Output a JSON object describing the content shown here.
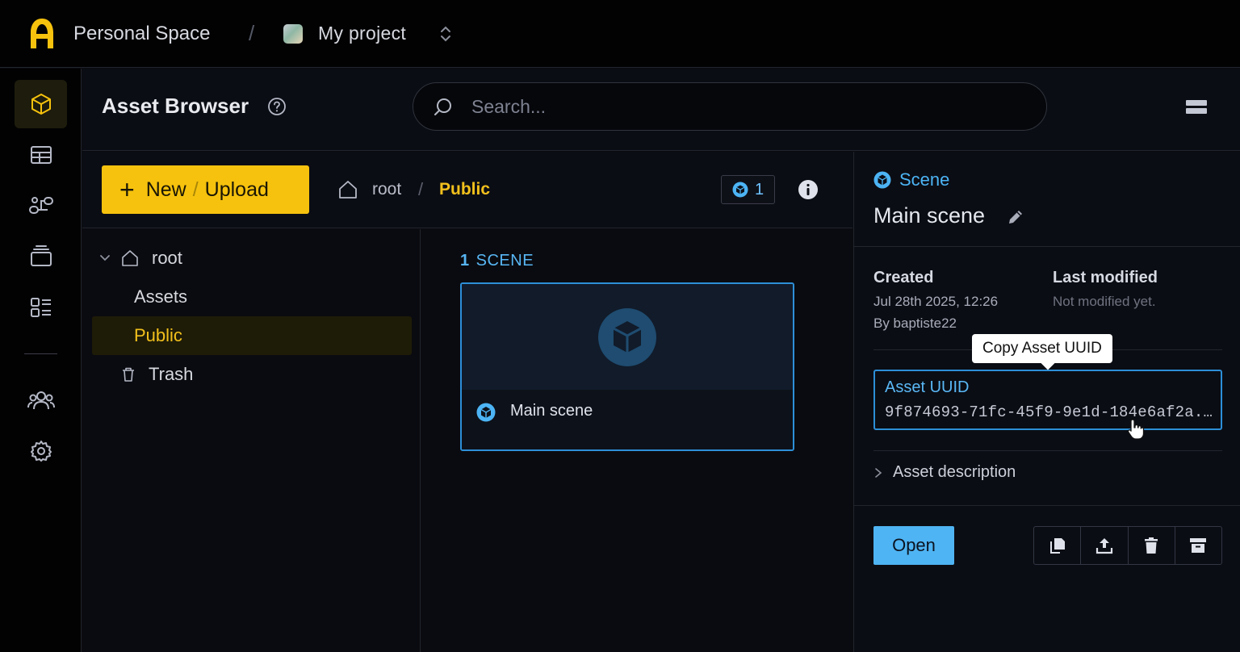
{
  "topbar": {
    "workspace": "Personal Space",
    "separator": "/",
    "project": "My project"
  },
  "header": {
    "title": "Asset Browser",
    "search_placeholder": "Search..."
  },
  "toolbar": {
    "new_label": "New",
    "separator": "/",
    "upload_label": "Upload",
    "breadcrumb": {
      "root": "root",
      "separator": "/",
      "current": "Public"
    },
    "asset_count": "1"
  },
  "tree": {
    "root": "root",
    "items": [
      "Assets",
      "Public",
      "Trash"
    ]
  },
  "content": {
    "section_count": "1",
    "section_label": "SCENE",
    "card_name": "Main scene"
  },
  "panel": {
    "type": "Scene",
    "title": "Main scene",
    "created_label": "Created",
    "created_date": "Jul 28th 2025, 12:26",
    "created_by": "By baptiste22",
    "modified_label": "Last modified",
    "modified_value": "Not modified yet.",
    "tooltip": "Copy Asset UUID",
    "uuid_label": "Asset UUID",
    "uuid_value": "9f874693-71fc-45f9-9e1d-184e6af2a...",
    "description_label": "Asset description",
    "open_label": "Open"
  },
  "colors": {
    "accent_yellow": "#f6c20d",
    "accent_blue": "#4fb4f3",
    "background": "#0a0b10"
  }
}
